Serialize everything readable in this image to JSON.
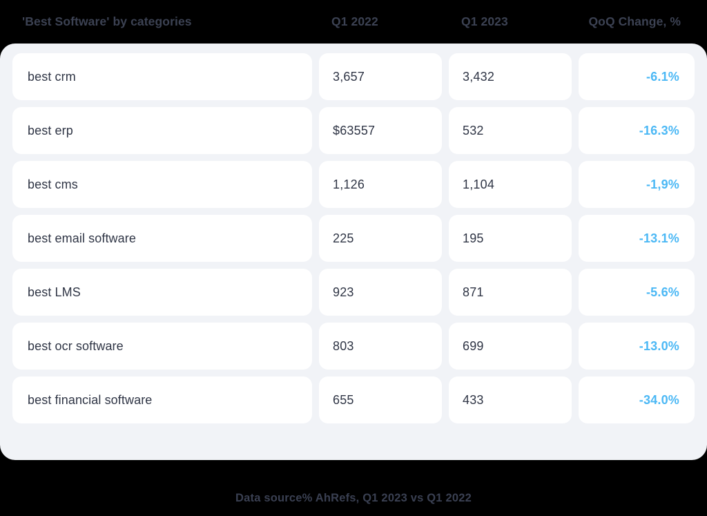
{
  "header": {
    "category_label": "'Best Software' by categories",
    "col_q1_2022": "Q1 2022",
    "col_q1_2023": "Q1 2023",
    "col_change": "QoQ Change, %"
  },
  "accent_color": "#4bb8f5",
  "text_color": "#2f3545",
  "panel_color": "#f1f3f7",
  "background_color": "#000000",
  "rows": [
    {
      "category": "best crm",
      "q1_2022": "3,657",
      "q1_2023": "3,432",
      "change": "-6.1%"
    },
    {
      "category": "best erp",
      "q1_2022": "$63557",
      "q1_2023": "532",
      "change": "-16.3%"
    },
    {
      "category": "best cms",
      "q1_2022": "1,126",
      "q1_2023": "1,104",
      "change": "-1,9%"
    },
    {
      "category": "best email software",
      "q1_2022": "225",
      "q1_2023": "195",
      "change": "-13.1%"
    },
    {
      "category": "best LMS",
      "q1_2022": "923",
      "q1_2023": "871",
      "change": "-5.6%"
    },
    {
      "category": "best ocr software",
      "q1_2022": "803",
      "q1_2023": "699",
      "change": "-13.0%"
    },
    {
      "category": "best financial software",
      "q1_2022": "655",
      "q1_2023": "433",
      "change": "-34.0%"
    }
  ],
  "footer": {
    "source_note": "Data source% AhRefs, Q1 2023 vs Q1 2022"
  },
  "chart_data": {
    "type": "table",
    "title": "'Best Software' by categories",
    "columns": [
      "'Best Software' by categories",
      "Q1 2022",
      "Q1 2023",
      "QoQ Change, %"
    ],
    "categories": [
      "best crm",
      "best erp",
      "best cms",
      "best email software",
      "best LMS",
      "best ocr software",
      "best financial software"
    ],
    "series": [
      {
        "name": "Q1 2022",
        "values": [
          3657,
          63557,
          1126,
          225,
          923,
          803,
          655
        ]
      },
      {
        "name": "Q1 2023",
        "values": [
          3432,
          532,
          1104,
          195,
          871,
          699,
          433
        ]
      },
      {
        "name": "QoQ Change, %",
        "values": [
          -6.1,
          -16.3,
          -1.9,
          -13.1,
          -5.6,
          -13.0,
          -34.0
        ]
      }
    ],
    "annotations": [
      "Data source% AhRefs, Q1 2023 vs Q1 2022"
    ],
    "legend": "none",
    "grid": false
  }
}
